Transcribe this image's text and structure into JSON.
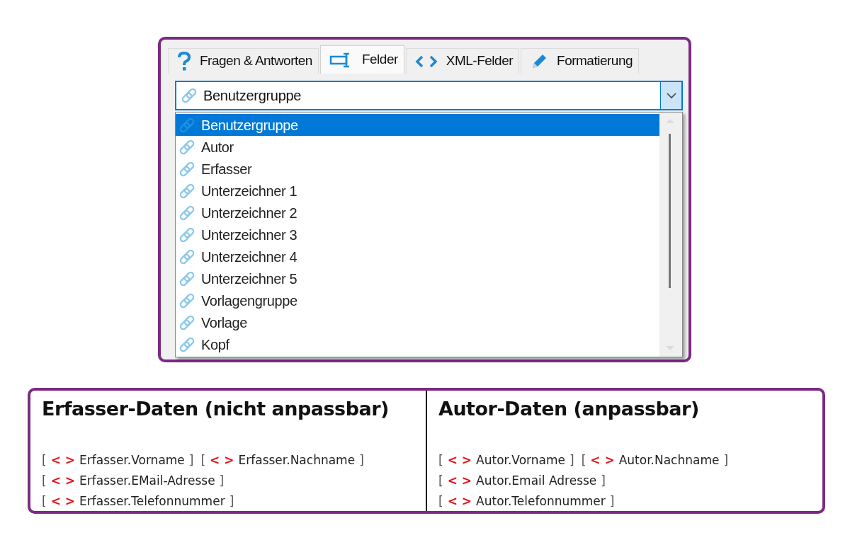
{
  "tabs": [
    {
      "label": "Fragen & Antworten",
      "kind": "question",
      "selected": false
    },
    {
      "label": "Felder",
      "kind": "field",
      "selected": true
    },
    {
      "label": "XML-Felder",
      "kind": "code",
      "selected": false
    },
    {
      "label": "Formatierung",
      "kind": "pencil",
      "selected": false
    }
  ],
  "combo": {
    "value": "Benutzergruppe"
  },
  "dropdown": {
    "items": [
      {
        "label": "Benutzergruppe",
        "selected": true
      },
      {
        "label": "Autor",
        "selected": false
      },
      {
        "label": "Erfasser",
        "selected": false
      },
      {
        "label": "Unterzeichner 1",
        "selected": false
      },
      {
        "label": "Unterzeichner 2",
        "selected": false
      },
      {
        "label": "Unterzeichner 3",
        "selected": false
      },
      {
        "label": "Unterzeichner 4",
        "selected": false
      },
      {
        "label": "Unterzeichner 5",
        "selected": false
      },
      {
        "label": "Vorlagengruppe",
        "selected": false
      },
      {
        "label": "Vorlage",
        "selected": false
      },
      {
        "label": "Kopf",
        "selected": false
      }
    ]
  },
  "data_columns": [
    {
      "title": "Erfasser-Daten (nicht anpassbar)",
      "lines": [
        [
          {
            "open": "[",
            "marker": "< >",
            "name": "Erfasser.Vorname",
            "close": "]"
          },
          {
            "open": "[",
            "marker": "< >",
            "name": "Erfasser.Nachname",
            "close": "]"
          }
        ],
        [
          {
            "open": "[",
            "marker": "< >",
            "name": "Erfasser.EMail-Adresse",
            "close": "]"
          }
        ],
        [
          {
            "open": "[",
            "marker": "< >",
            "name": "Erfasser.Telefonnummer",
            "close": "]"
          }
        ]
      ]
    },
    {
      "title": "Autor-Daten (anpassbar)",
      "lines": [
        [
          {
            "open": "[",
            "marker": "< >",
            "name": "Autor.Vorname",
            "close": "]"
          },
          {
            "open": "[",
            "marker": "< >",
            "name": "Autor.Nachname",
            "close": "]"
          }
        ],
        [
          {
            "open": "[",
            "marker": "< >",
            "name": "Autor.Email Adresse",
            "close": "]"
          }
        ],
        [
          {
            "open": "[",
            "marker": "< >",
            "name": "Autor.Telefonnummer",
            "close": "]"
          }
        ]
      ]
    }
  ]
}
